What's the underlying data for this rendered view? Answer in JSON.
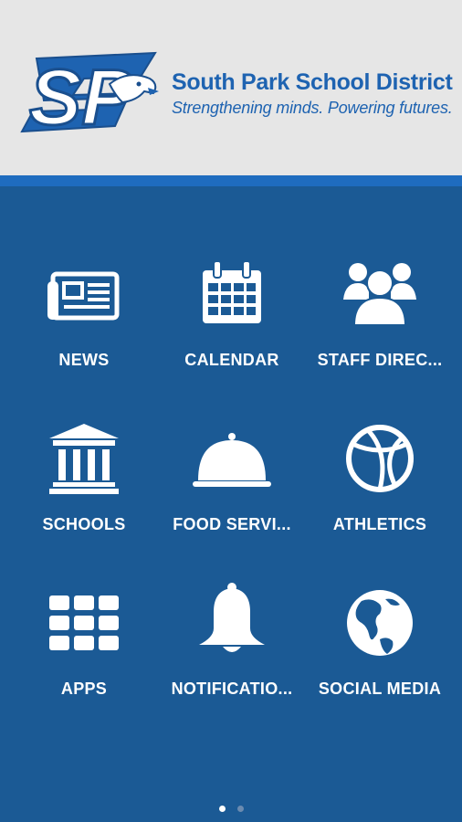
{
  "header": {
    "district_name": "South Park School District",
    "tagline": "Strengthening minds. Powering futures.",
    "logo_icon": "sp-eagle-logo"
  },
  "colors": {
    "header_bg": "#e6e6e6",
    "brand_blue": "#1e63b1",
    "grid_bg": "#1b5a95",
    "tile_icon": "#ffffff"
  },
  "tiles": [
    {
      "label": "NEWS",
      "icon": "newspaper-icon"
    },
    {
      "label": "CALENDAR",
      "icon": "calendar-icon"
    },
    {
      "label": "STAFF DIREC...",
      "icon": "people-icon"
    },
    {
      "label": "SCHOOLS",
      "icon": "building-icon"
    },
    {
      "label": "FOOD SERVI...",
      "icon": "cloche-icon"
    },
    {
      "label": "ATHLETICS",
      "icon": "basketball-icon"
    },
    {
      "label": "APPS",
      "icon": "apps-grid-icon"
    },
    {
      "label": "NOTIFICATIO...",
      "icon": "bell-icon"
    },
    {
      "label": "SOCIAL MEDIA",
      "icon": "globe-icon"
    }
  ],
  "pager": {
    "pages": 2,
    "current": 1
  }
}
